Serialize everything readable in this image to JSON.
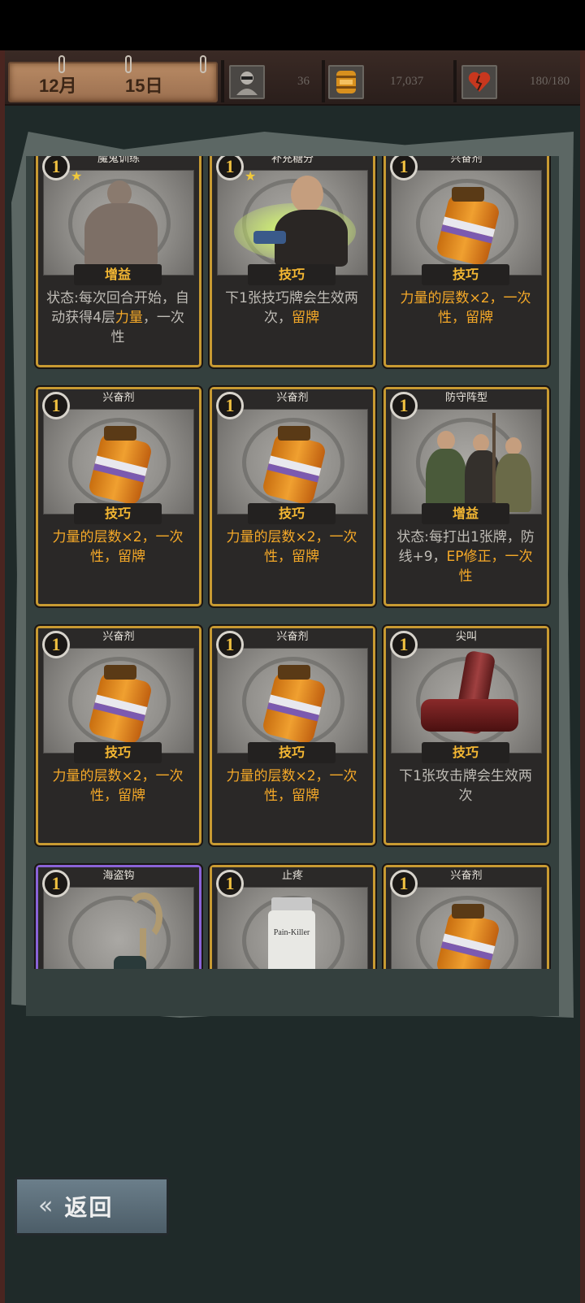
{
  "calendar": {
    "month": "12月",
    "day": "15日"
  },
  "stats": {
    "avatar_value": "36",
    "coins": "17,037",
    "health": "180/180"
  },
  "cards": [
    {
      "cost": "1",
      "title": "魔鬼训练",
      "star": true,
      "type": "增益",
      "art": "muscle-man",
      "desc_pre": "状态:每次回合开始，自动获得4层",
      "desc_hl": "力量",
      "desc_post": "，一次性"
    },
    {
      "cost": "1",
      "title": "补充糖分",
      "star": true,
      "type": "技巧",
      "art": "bald-man",
      "desc_pre": "下1张技巧牌会生效两次，",
      "desc_hl": "留牌",
      "desc_post": ""
    },
    {
      "cost": "1",
      "title": "兴奋剂",
      "star": false,
      "type": "技巧",
      "art": "bottle",
      "desc_pre": "",
      "desc_hl": "力量的层数×2，一次性，留牌",
      "desc_post": ""
    },
    {
      "cost": "1",
      "title": "兴奋剂",
      "star": false,
      "type": "技巧",
      "art": "bottle",
      "desc_pre": "",
      "desc_hl": "力量的层数×2，一次性，留牌",
      "desc_post": ""
    },
    {
      "cost": "1",
      "title": "兴奋剂",
      "star": false,
      "type": "技巧",
      "art": "bottle",
      "desc_pre": "",
      "desc_hl": "力量的层数×2，一次性，留牌",
      "desc_post": ""
    },
    {
      "cost": "1",
      "title": "防守阵型",
      "star": false,
      "type": "增益",
      "art": "group",
      "desc_pre": "状态:每打出1张牌，防线+9，",
      "desc_hl": "EP修正，一次性",
      "desc_post": ""
    },
    {
      "cost": "1",
      "title": "兴奋剂",
      "star": false,
      "type": "技巧",
      "art": "bottle",
      "desc_pre": "",
      "desc_hl": "力量的层数×2，一次性，留牌",
      "desc_post": ""
    },
    {
      "cost": "1",
      "title": "兴奋剂",
      "star": false,
      "type": "技巧",
      "art": "bottle",
      "desc_pre": "",
      "desc_hl": "力量的层数×2，一次性，留牌",
      "desc_post": ""
    },
    {
      "cost": "1",
      "title": "尖叫",
      "star": false,
      "type": "技巧",
      "art": "bottles-red",
      "desc_pre": "下1张攻击牌会生效两次",
      "desc_hl": "",
      "desc_post": ""
    },
    {
      "cost": "1",
      "title": "海盗钩",
      "star": false,
      "type": "",
      "art": "hook",
      "purple": true,
      "desc_pre": "",
      "desc_hl": "",
      "desc_post": ""
    },
    {
      "cost": "1",
      "title": "止疼",
      "star": false,
      "type": "",
      "art": "pill-bottle",
      "pill_label": "Pain-Killer",
      "desc_pre": "",
      "desc_hl": "",
      "desc_post": ""
    },
    {
      "cost": "1",
      "title": "兴奋剂",
      "star": false,
      "type": "",
      "art": "bottle",
      "desc_pre": "",
      "desc_hl": "",
      "desc_post": ""
    }
  ],
  "back_button": {
    "label": "返回"
  },
  "colors": {
    "gold_border": "#c89a32",
    "highlight": "#f5a928",
    "purple_border": "#8a63d8"
  }
}
